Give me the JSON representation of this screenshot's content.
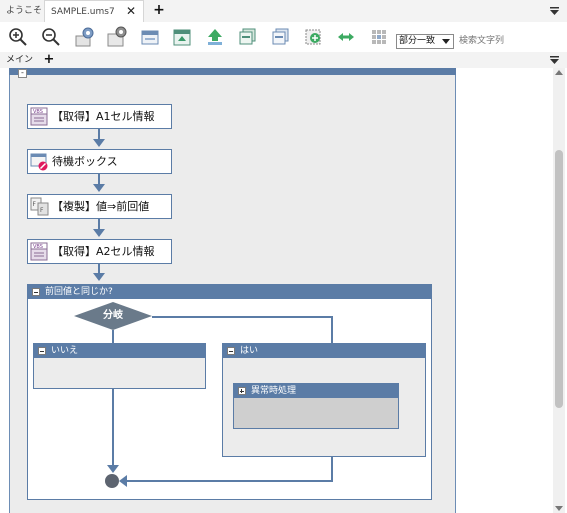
{
  "tabs": [
    {
      "label": "ようこそ"
    },
    {
      "label": "SAMPLE.ums7"
    }
  ],
  "toolbar": {
    "buttons": [
      "zoom-in-icon",
      "zoom-out-icon",
      "settings-a-icon",
      "settings-b-icon",
      "window-a-icon",
      "window-b-icon",
      "upload-icon",
      "stack-a-icon",
      "stack-b-icon",
      "add-frame-icon",
      "swap-arrows-icon",
      "grid-icon"
    ],
    "match_mode": "部分一致",
    "search_placeholder": "検索文字列"
  },
  "subtabs": {
    "main": "メイン"
  },
  "flow": {
    "nodes": [
      {
        "label": "【取得】A1セル情報",
        "icon": "vbs-icon"
      },
      {
        "label": "待機ボックス",
        "icon": "wait-box-icon"
      },
      {
        "label": "【複製】値⇒前回値",
        "icon": "copy-icon"
      },
      {
        "label": "【取得】A2セル情報",
        "icon": "vbs-icon"
      }
    ],
    "condition_group": {
      "title": "前回値と同じか?",
      "diamond": "分岐",
      "branch_no": "いいえ",
      "branch_yes": "はい",
      "inner_group": "異常時処理"
    }
  },
  "colors": {
    "frame": "#5b7ca6",
    "canvas_bg": "#ececec",
    "endpoint": "#5d6470"
  }
}
